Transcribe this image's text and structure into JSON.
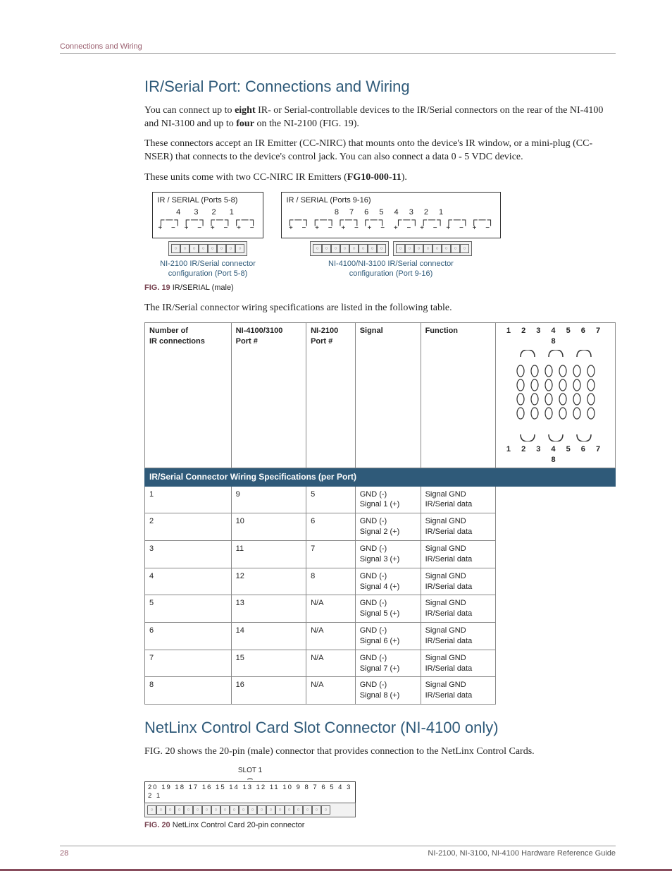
{
  "breadcrumb": "Connections and Wiring",
  "section1": {
    "title": "IR/Serial Port: Connections and Wiring",
    "p1_a": "You can connect up to ",
    "p1_b": "eight",
    "p1_c": " IR- or Serial-controllable devices to the IR/Serial connectors on the rear of the NI-4100 and NI-3100 and up to ",
    "p1_d": "four",
    "p1_e": " on the NI-2100 (FIG. 19).",
    "p2": "These connectors accept an IR Emitter (CC-NIRC) that mounts onto the device's IR window, or a mini-plug (CC-NSER) that connects to the device's control jack. You can also connect a data 0 - 5 VDC device.",
    "p3_a": "These units come with two CC-NIRC IR Emitters (",
    "p3_b": "FG10-000-11",
    "p3_c": ").",
    "fig19": {
      "left_title": "IR / SERIAL (Ports 5-8)",
      "right_title": "IR / SERIAL (Ports 9-16)",
      "left_nums": "4   3   2   1",
      "right_nums": "8   7   6   5     4   3   2   1",
      "polarity4": "+ − + − + − + −",
      "polarity8": "+ − + − + − + −   + − + − + − + −",
      "left_link_a": "NI-2100 IR/Serial connector",
      "left_link_b": "configuration (Port 5-8)",
      "right_link_a": "NI-4100/NI-3100 IR/Serial connector",
      "right_link_b": "configuration (Port 9-16)",
      "caption_num": "FIG. 19",
      "caption_text": "  IR/SERIAL (male)"
    },
    "p4": "The IR/Serial connector wiring specifications are listed in the following table.",
    "table": {
      "title": "IR/Serial Connector Wiring Specifications (per Port)",
      "headers": {
        "h1a": "Number of",
        "h1b": "IR connections",
        "h2a": "NI-4100/3100",
        "h2b": "Port #",
        "h3a": "NI-2100",
        "h3b": "Port #",
        "h4": "Signal",
        "h5": "Function"
      },
      "rows": [
        {
          "n": "1",
          "p4": "9",
          "p2": "5",
          "sig_a": "GND (-)",
          "sig_b": "Signal 1 (+)",
          "fn_a": "Signal GND",
          "fn_b": "IR/Serial data"
        },
        {
          "n": "2",
          "p4": "10",
          "p2": "6",
          "sig_a": "GND (-)",
          "sig_b": "Signal 2 (+)",
          "fn_a": "Signal GND",
          "fn_b": "IR/Serial data"
        },
        {
          "n": "3",
          "p4": "11",
          "p2": "7",
          "sig_a": "GND (-)",
          "sig_b": "Signal 3 (+)",
          "fn_a": "Signal GND",
          "fn_b": "IR/Serial data"
        },
        {
          "n": "4",
          "p4": "12",
          "p2": "8",
          "sig_a": "GND (-)",
          "sig_b": "Signal 4 (+)",
          "fn_a": "Signal GND",
          "fn_b": "IR/Serial data"
        },
        {
          "n": "5",
          "p4": "13",
          "p2": "N/A",
          "sig_a": "GND (-)",
          "sig_b": "Signal 5 (+)",
          "fn_a": "Signal GND",
          "fn_b": "IR/Serial data"
        },
        {
          "n": "6",
          "p4": "14",
          "p2": "N/A",
          "sig_a": "GND (-)",
          "sig_b": "Signal 6 (+)",
          "fn_a": "Signal GND",
          "fn_b": "IR/Serial data"
        },
        {
          "n": "7",
          "p4": "15",
          "p2": "N/A",
          "sig_a": "GND (-)",
          "sig_b": "Signal 7 (+)",
          "fn_a": "Signal GND",
          "fn_b": "IR/Serial data"
        },
        {
          "n": "8",
          "p4": "16",
          "p2": "N/A",
          "sig_a": "GND (-)",
          "sig_b": "Signal 8 (+)",
          "fn_a": "Signal GND",
          "fn_b": "IR/Serial data"
        }
      ],
      "diag_top": "1 2 3  4 5 6  7 8",
      "diag_bot": "1 2 3  4 5 6  7 8"
    }
  },
  "section2": {
    "title": "NetLinx Control Card Slot Connector (NI-4100 only)",
    "p1": "FIG. 20 shows the 20-pin (male) connector that provides connection to the NetLinx Control Cards.",
    "slot_label": "SLOT 1",
    "slot_nums": "20 19 18 17 16 15 14 13 12 11 10  9  8  7  6  5  4  3  2  1",
    "caption_num": "FIG. 20",
    "caption_text": "  NetLinx Control Card 20-pin connector"
  },
  "footer": {
    "page": "28",
    "title": "NI-2100, NI-3100, NI-4100 Hardware Reference Guide"
  }
}
